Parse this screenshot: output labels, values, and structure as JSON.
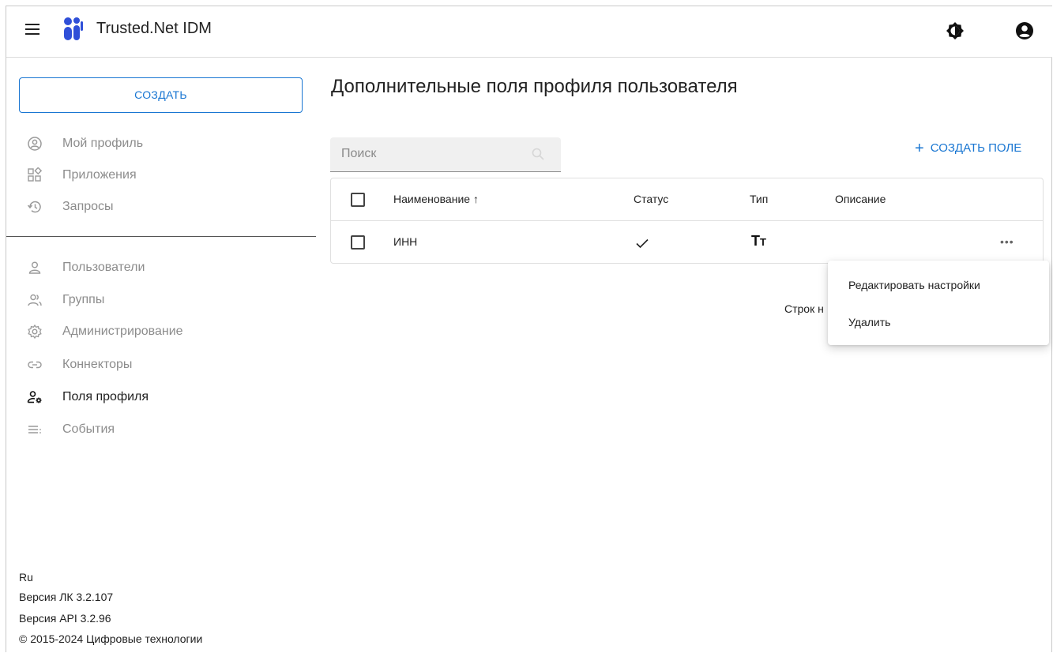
{
  "app": {
    "title": "Trusted.Net IDM"
  },
  "icons": {
    "menu": "hamburger-icon",
    "logo": "trusted-logo",
    "theme": "brightness-icon",
    "account": "account-circle-icon"
  },
  "colors": {
    "accent": "#1976d2",
    "logo": "#2f4fd8"
  },
  "sidebar": {
    "create_label": "СОЗДАТЬ",
    "group1": [
      {
        "label": "Мой профиль",
        "icon": "account-circle-outline-icon"
      },
      {
        "label": "Приложения",
        "icon": "apps-icon"
      },
      {
        "label": "Запросы",
        "icon": "history-icon"
      }
    ],
    "group2": [
      {
        "label": "Пользователи",
        "icon": "person-icon"
      },
      {
        "label": "Группы",
        "icon": "group-icon"
      },
      {
        "label": "Администрирование",
        "icon": "settings-icon"
      },
      {
        "label": "Коннекторы",
        "icon": "link-icon"
      },
      {
        "label": "Поля профиля",
        "icon": "manage-accounts-icon",
        "active": true
      },
      {
        "label": "События",
        "icon": "list-icon"
      }
    ],
    "footer": {
      "lang": "Ru",
      "version_lk": "Версия ЛК 3.2.107",
      "version_api": "Версия API 3.2.96",
      "copyright": "© 2015-2024 Цифровые технологии"
    }
  },
  "main": {
    "title": "Дополнительные поля профиля пользователя",
    "search_placeholder": "Поиск",
    "create_field_label": "СОЗДАТЬ ПОЛЕ",
    "table": {
      "headers": {
        "name": "Наименование ↑",
        "status": "Статус",
        "type": "Тип",
        "description": "Описание"
      },
      "rows": [
        {
          "name": "ИНН",
          "status": "✓",
          "type_icon": "text-fields-icon",
          "description": ""
        }
      ]
    },
    "rows_label": "Строк н"
  },
  "context_menu": {
    "items": [
      "Редактировать настройки",
      "Удалить"
    ]
  }
}
